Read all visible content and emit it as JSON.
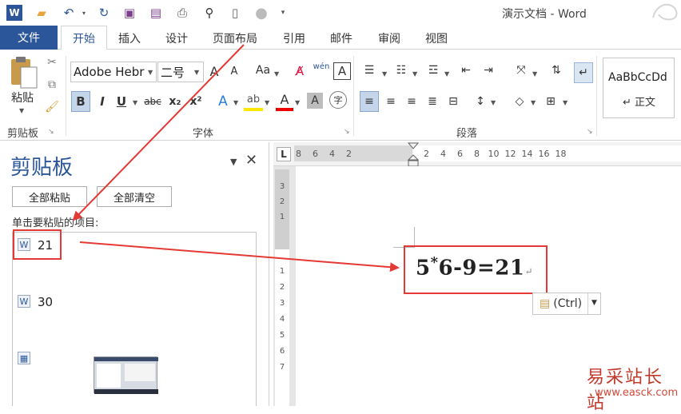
{
  "app": {
    "title": "演示文档 - Word"
  },
  "quick_access": {
    "icons": [
      "word-icon",
      "open-folder-icon",
      "undo-icon",
      "redo-icon",
      "save-icon",
      "save-as-icon",
      "print-preview-icon",
      "find-icon",
      "new-doc-icon",
      "circle-icon",
      "customize-icon"
    ]
  },
  "tabs": {
    "file": "文件",
    "items": [
      "开始",
      "插入",
      "设计",
      "页面布局",
      "引用",
      "邮件",
      "审阅",
      "视图"
    ]
  },
  "ribbon": {
    "clipboard": {
      "paste": "粘贴",
      "group_label": "剪贴板"
    },
    "font": {
      "name": "Adobe Hebr",
      "size": "二号",
      "group_label": "字体",
      "aa_label": "Aa",
      "bold": "B",
      "italic": "I",
      "underline": "U",
      "strike": "abc",
      "subscript": "x₂",
      "superscript": "x²",
      "char_border": "A",
      "char_shade": "A",
      "grow": "A",
      "shrink": "A",
      "pinyin": "wén",
      "circle": "字"
    },
    "paragraph": {
      "group_label": "段落"
    },
    "styles": {
      "preview": "AaBbCcDd",
      "normal": "↵ 正文"
    }
  },
  "pane": {
    "title": "剪贴板",
    "paste_all": "全部粘贴",
    "clear_all": "全部清空",
    "instruction": "单击要粘贴的项目:",
    "items": [
      {
        "text": "21"
      },
      {
        "text": "30"
      }
    ]
  },
  "ruler": {
    "marks": [
      "8",
      "6",
      "4",
      "2",
      "2",
      "4",
      "6",
      "8",
      "10",
      "12",
      "14",
      "16",
      "18"
    ],
    "vmarks": [
      "3",
      "2",
      "1",
      "1",
      "2",
      "3",
      "4",
      "5",
      "6",
      "7"
    ],
    "corner": "L"
  },
  "document": {
    "formula_a": "5",
    "formula_star": "*",
    "formula_b": "6-9=21",
    "para_mark": "↵"
  },
  "paste_options": {
    "label": "(Ctrl)",
    "caret": "▼"
  },
  "watermark": {
    "site": "易采站长站",
    "url": "www.easck.com"
  }
}
